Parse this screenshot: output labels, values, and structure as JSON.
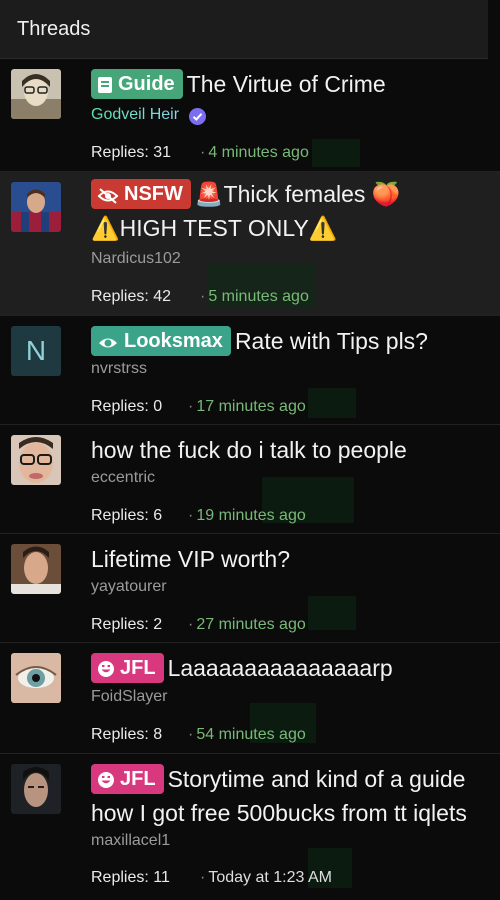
{
  "header": {
    "title": "Threads"
  },
  "threads": [
    {
      "badge": "Guide",
      "title": "The Virtue of Crime",
      "author": "Godveil Heir",
      "replies": "Replies: 31",
      "time": "4 minutes ago"
    },
    {
      "badge": "NSFW",
      "title_line1": "🚨Thick females 🍑",
      "title_line2": "⚠️HIGH TEST ONLY⚠️",
      "author": "Nardicus102",
      "replies": "Replies: 42",
      "time": "5 minutes ago"
    },
    {
      "avatar_letter": "N",
      "badge": "Looksmax",
      "title": "Rate with Tips pls?",
      "author": "nvrstrss",
      "replies": "Replies: 0",
      "time": "17 minutes ago"
    },
    {
      "title": "how the fuck do i talk to people",
      "author": "eccentric",
      "replies": "Replies: 6",
      "time": "19 minutes ago"
    },
    {
      "title": "Lifetime VIP worth?",
      "author": "yayatourer",
      "replies": "Replies: 2",
      "time": "27 minutes ago"
    },
    {
      "badge": "JFL",
      "title": "Laaaaaaaaaaaaaaarp",
      "author": "FoidSlayer",
      "replies": "Replies: 8",
      "time": "54 minutes ago"
    },
    {
      "badge": "JFL",
      "title": "Storytime and kind of a guide how I got free 500bucks from tt iqlets",
      "author": "maxillacel1",
      "replies": "Replies: 11",
      "time": "Today at 1:23 AM"
    }
  ],
  "colors": {
    "guide": "#46a67a",
    "nsfw": "#c93a33",
    "looksmax": "#3aa389",
    "jfl": "#d8387e",
    "time": "#78b978"
  }
}
